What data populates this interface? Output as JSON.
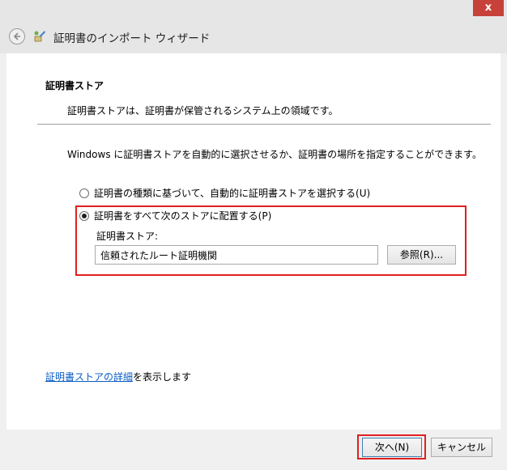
{
  "window": {
    "close_label": "x"
  },
  "header": {
    "title": "証明書のインポート ウィザード"
  },
  "section": {
    "title": "証明書ストア",
    "description": "証明書ストアは、証明書が保管されるシステム上の領域です。"
  },
  "instruction": "Windows に証明書ストアを自動的に選択させるか、証明書の場所を指定することができます。",
  "options": [
    {
      "label": "証明書の種類に基づいて、自動的に証明書ストアを選択する(U)",
      "checked": false
    },
    {
      "label": "証明書をすべて次のストアに配置する(P)",
      "checked": true
    }
  ],
  "store": {
    "label": "証明書ストア:",
    "value": "信頼されたルート証明機関",
    "browse_label": "参照(R)..."
  },
  "details": {
    "link_text": "証明書ストアの詳細",
    "suffix_text": "を表示します"
  },
  "footer": {
    "next_label": "次へ(N)",
    "cancel_label": "キャンセル"
  },
  "colors": {
    "highlight": "#e02020",
    "link": "#0b5dc4",
    "close": "#c7413b"
  }
}
